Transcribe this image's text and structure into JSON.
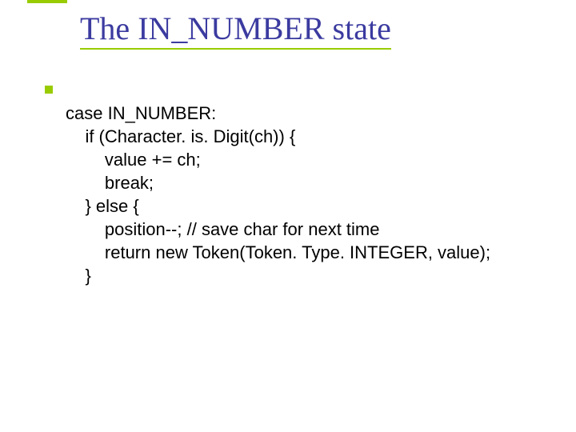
{
  "title": "The IN_NUMBER state",
  "code_lines": {
    "l1": "case IN_NUMBER:",
    "l2": "    if (Character. is. Digit(ch)) {",
    "l3": "        value += ch;",
    "l4": "        break;",
    "l5": "    } else {",
    "l6": "        position--; // save char for next time",
    "l7": "        return new Token(Token. Type. INTEGER, value);",
    "l8": "    }"
  }
}
